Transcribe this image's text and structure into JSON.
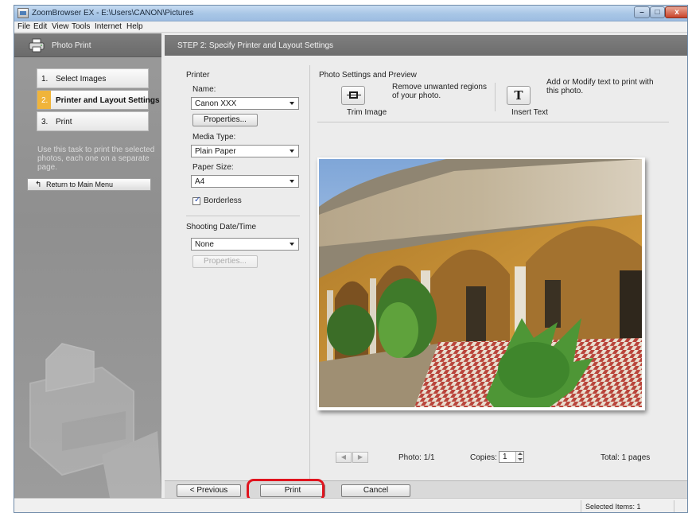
{
  "window": {
    "title": "ZoomBrowser EX  -  E:\\Users\\CANON\\Pictures",
    "controls": {
      "minimize": "–",
      "maximize": "□",
      "close": "x"
    }
  },
  "menu": [
    "File",
    "Edit",
    "View",
    "Tools",
    "Internet",
    "Help"
  ],
  "left_panel": {
    "title": "Photo Print",
    "steps": [
      {
        "num": "1.",
        "label": "Select Images"
      },
      {
        "num": "2.",
        "label": "Printer and Layout Settings"
      },
      {
        "num": "3.",
        "label": "Print"
      }
    ],
    "active_step": 2,
    "description": "Use this task to print the selected photos, each one on a separate page.",
    "return_button": "Return to Main Menu"
  },
  "main": {
    "step_title": "STEP 2: Specify Printer and Layout Settings",
    "printer": {
      "section": "Printer",
      "name_label": "Name:",
      "name_value": "Canon XXX",
      "properties_button": "Properties...",
      "media_label": "Media Type:",
      "media_value": "Plain Paper",
      "paper_label": "Paper Size:",
      "paper_value": "A4",
      "borderless_label": "Borderless",
      "borderless_checked": true
    },
    "shooting": {
      "section": "Shooting Date/Time",
      "value": "None",
      "properties_button": "Properties..."
    },
    "photo_settings": {
      "section": "Photo Settings and Preview",
      "trim_desc": "Remove unwanted regions of your photo.",
      "trim_label": "Trim Image",
      "text_desc": "Add or Modify text to print with this photo.",
      "text_label": "Insert Text"
    },
    "preview_nav": {
      "prev": "◀",
      "next": "▶",
      "photo_counter": "Photo: 1/1",
      "copies_label": "Copies:",
      "copies_value": "1",
      "total_pages": "Total: 1 pages"
    },
    "buttons": {
      "previous": "< Previous",
      "print": "Print",
      "cancel": "Cancel"
    }
  },
  "status": {
    "selected": "Selected Items: 1"
  },
  "colors": {
    "highlight": "#e0141e",
    "active_step": "#f0b43a",
    "panel": "#959595"
  }
}
